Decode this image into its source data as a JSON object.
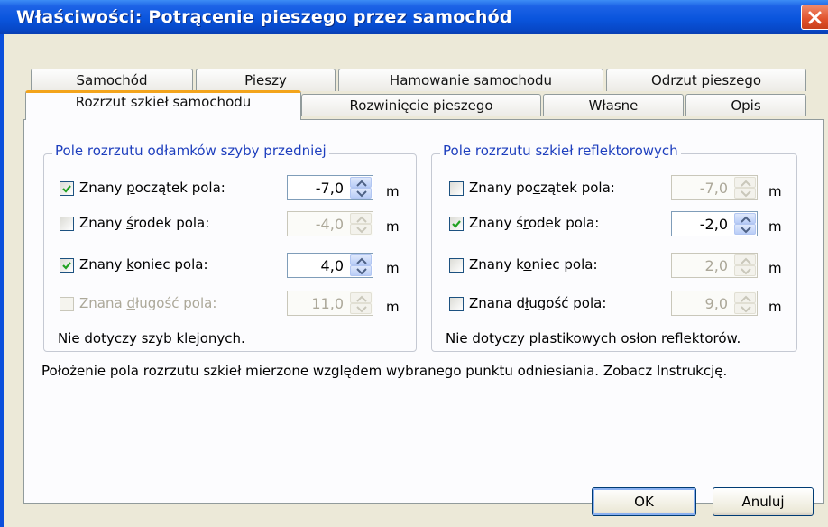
{
  "window": {
    "title": "Właściwości: Potrącenie pieszego przez samochód"
  },
  "tabs_row1": [
    "Samochód",
    "Pieszy",
    "Hamowanie samochodu",
    "Odrzut pieszego"
  ],
  "tabs_row2": [
    "Rozrzut szkieł samochodu",
    "Rozwinięcie pieszego",
    "Własne",
    "Opis"
  ],
  "active_tab": "Rozrzut szkieł samochodu",
  "windshield": {
    "title": "Pole rozrzutu odłamków szyby przedniej",
    "rows": [
      {
        "pre": "Znany ",
        "acc": "p",
        "post": "oczątek pola:",
        "checked": true,
        "enabled": true,
        "value": "-7,0",
        "value_enabled": true,
        "unit": "m"
      },
      {
        "pre": "Znany ",
        "acc": "ś",
        "post": "rodek pola:",
        "checked": false,
        "enabled": true,
        "value": "-4,0",
        "value_enabled": false,
        "unit": "m"
      },
      {
        "pre": "Znany ",
        "acc": "k",
        "post": "oniec pola:",
        "checked": true,
        "enabled": true,
        "value": "4,0",
        "value_enabled": true,
        "unit": "m"
      },
      {
        "pre": "Znana ",
        "acc": "d",
        "post": "ługość pola:",
        "checked": false,
        "enabled": false,
        "value": "11,0",
        "value_enabled": false,
        "unit": "m"
      }
    ],
    "note": "Nie dotyczy szyb klejonych."
  },
  "headlights": {
    "title": "Pole rozrzutu szkieł reflektorowych",
    "rows": [
      {
        "pre": "Znany ",
        "acc": "c",
        "post": "zątek pola:",
        "pre2": "po",
        "checked": false,
        "enabled": true,
        "value": "-7,0",
        "value_enabled": false,
        "unit": "m"
      },
      {
        "pre": "Znany ",
        "acc": "r",
        "post": "odek pola:",
        "pre2": "ś",
        "checked": true,
        "enabled": true,
        "value": "-2,0",
        "value_enabled": true,
        "unit": "m"
      },
      {
        "pre": "Znany ",
        "acc": "o",
        "post": "niec pola:",
        "pre2": "k",
        "checked": false,
        "enabled": true,
        "value": "2,0",
        "value_enabled": false,
        "unit": "m"
      },
      {
        "pre": "Znana ",
        "acc": "ł",
        "post": "ugość pola:",
        "pre2": "d",
        "checked": false,
        "enabled": true,
        "value": "9,0",
        "value_enabled": false,
        "unit": "m"
      }
    ],
    "note": "Nie dotyczy plastikowych osłon reflektorów."
  },
  "info": "Położenie pola rozrzutu szkieł mierzone względem wybranego punktu odniesiania. Zobacz Instrukcję.",
  "buttons": {
    "ok": "OK",
    "cancel": "Anuluj"
  },
  "colors": {
    "titlebar": "#0a55dd",
    "group_title": "#1e3fbe",
    "active_tab_accent": "#f3a41c",
    "face": "#ece9d8"
  }
}
